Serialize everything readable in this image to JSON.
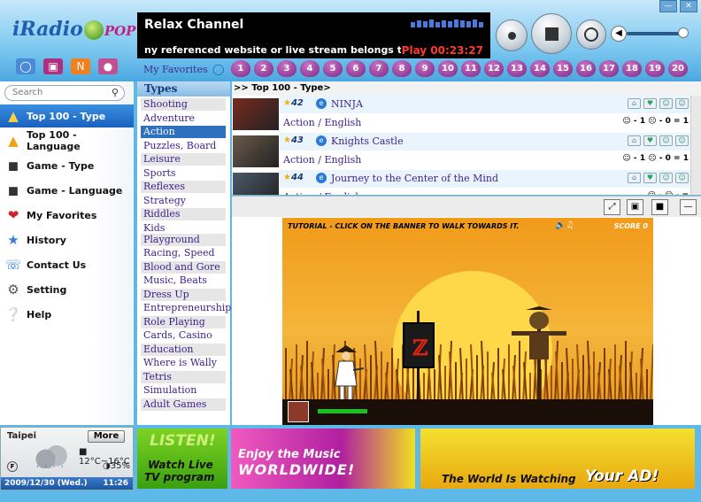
{
  "app": {
    "logo_text": "iRadio",
    "logo_suffix": "POP"
  },
  "player": {
    "channel": "Relax Channel",
    "marquee": "ny referenced website or live stream belongs to the broad",
    "play_time": "Play 00:23:27"
  },
  "window": {
    "minimize": "—",
    "close": "✕"
  },
  "favorites": {
    "label": "My Favorites",
    "numbers": [
      "1",
      "2",
      "3",
      "4",
      "5",
      "6",
      "7",
      "8",
      "9",
      "10",
      "11",
      "12",
      "13",
      "14",
      "15",
      "16",
      "17",
      "18",
      "19",
      "20"
    ]
  },
  "search": {
    "placeholder": "Search"
  },
  "nav": [
    {
      "label": "Top 100 - Type",
      "icon": "top100-type-icon",
      "active": true
    },
    {
      "label": "Top 100 - Language",
      "icon": "top100-language-icon"
    },
    {
      "label": "Game - Type",
      "icon": "game-type-icon"
    },
    {
      "label": "Game - Language",
      "icon": "game-language-icon"
    },
    {
      "label": "My Favorites",
      "icon": "heart-icon"
    },
    {
      "label": "History",
      "icon": "history-icon"
    },
    {
      "label": "Contact Us",
      "icon": "contact-icon"
    },
    {
      "label": "Setting",
      "icon": "gear-icon"
    },
    {
      "label": "Help",
      "icon": "help-icon"
    }
  ],
  "types": {
    "title": "Types",
    "items": [
      "Shooting",
      "Adventure",
      "Action",
      "Puzzles, Board",
      "Leisure",
      "Sports",
      "Reflexes",
      "Strategy",
      "Riddles",
      "Kids",
      "Playground",
      "Racing, Speed",
      "Blood and Gore",
      "Music, Beats",
      "Dress Up",
      "Entrepreneurship",
      "Role Playing",
      "Cards, Casino",
      "Education",
      "Where is Wally",
      "Tetris",
      "Simulation",
      "Adult Games"
    ],
    "selected": "Action"
  },
  "breadcrumb": ">> Top 100 - Type>",
  "games": [
    {
      "rank": "42",
      "name": "NINJA",
      "category": "Action / English",
      "votes_up": "1",
      "votes_down": "0",
      "total": "1"
    },
    {
      "rank": "43",
      "name": "Knights Castle",
      "category": "Action / English",
      "votes_up": "1",
      "votes_down": "0",
      "total": "1"
    },
    {
      "rank": "44",
      "name": "Journey to the Center of the Mind",
      "category": "Action / English",
      "votes_up": "",
      "votes_down": "",
      "total": ""
    }
  ],
  "vote_symbols": {
    "minus": "-",
    "eq": "="
  },
  "game_screen": {
    "tutorial": "TUTORIAL - CLICK ON THE BANNER TO WALK TOWARDS IT.",
    "score": "SCORE 0"
  },
  "weather": {
    "city": "Taipei",
    "more": "More",
    "temp": "12°C~16°C",
    "humidity": "35%",
    "date": "2009/12/30 (Wed.)",
    "time": "11:26",
    "badge": "F"
  },
  "ads": [
    {
      "line1": "LISTEN!",
      "line2": "Watch Live",
      "line3": "TV program"
    },
    {
      "line1": "Enjoy the Music",
      "line2": "WORLDWIDE!"
    },
    {
      "line1": "The World Is Watching",
      "line2": "Your AD!"
    }
  ],
  "colors": {
    "accent": "#2f6fc0",
    "link": "#3b1f8c",
    "play_time": "#ff3a2a"
  }
}
